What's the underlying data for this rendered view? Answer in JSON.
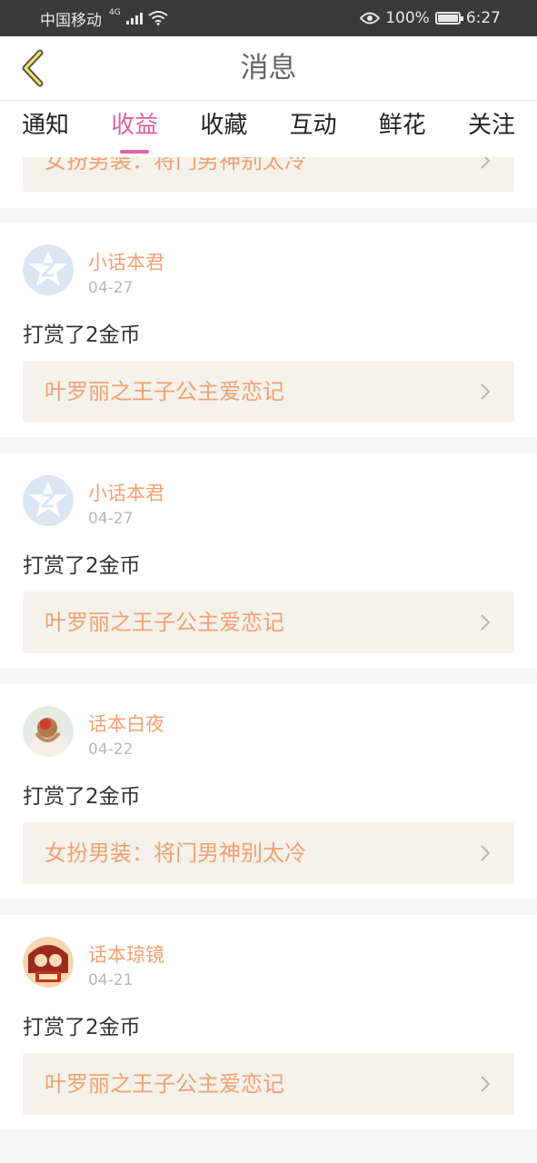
{
  "status_bar": {
    "carrier": "中国移动",
    "network": "4G",
    "battery": "100%",
    "time": "6:27"
  },
  "header": {
    "title": "消息",
    "back_icon": "chevron-left-icon"
  },
  "tabs": [
    {
      "label": "通知",
      "active": false
    },
    {
      "label": "收益",
      "active": true
    },
    {
      "label": "收藏",
      "active": false
    },
    {
      "label": "互动",
      "active": false
    },
    {
      "label": "鲜花",
      "active": false
    },
    {
      "label": "关注",
      "active": false
    }
  ],
  "partial_item": {
    "book": "女扮男装：将门男神别太冷"
  },
  "messages": [
    {
      "user": "小话本君",
      "date": "04-27",
      "text": "打赏了2金币",
      "book": "叶罗丽之王子公主爱恋记",
      "avatar": "z-star-avatar"
    },
    {
      "user": "小话本君",
      "date": "04-27",
      "text": "打赏了2金币",
      "book": "叶罗丽之王子公主爱恋记",
      "avatar": "z-star-avatar"
    },
    {
      "user": "话本白夜",
      "date": "04-22",
      "text": "打赏了2金币",
      "book": "女扮男装：将门男神别太冷",
      "avatar": "photo-avatar"
    },
    {
      "user": "话本琼镜",
      "date": "04-21",
      "text": "打赏了2金币",
      "book": "叶罗丽之王子公主爱恋记",
      "avatar": "illustration-avatar"
    }
  ],
  "colors": {
    "accent": "#e0609e",
    "book_link_text": "#f2a072",
    "book_link_bg": "#f4f2ea",
    "status_bar": "#3a3a3a"
  }
}
